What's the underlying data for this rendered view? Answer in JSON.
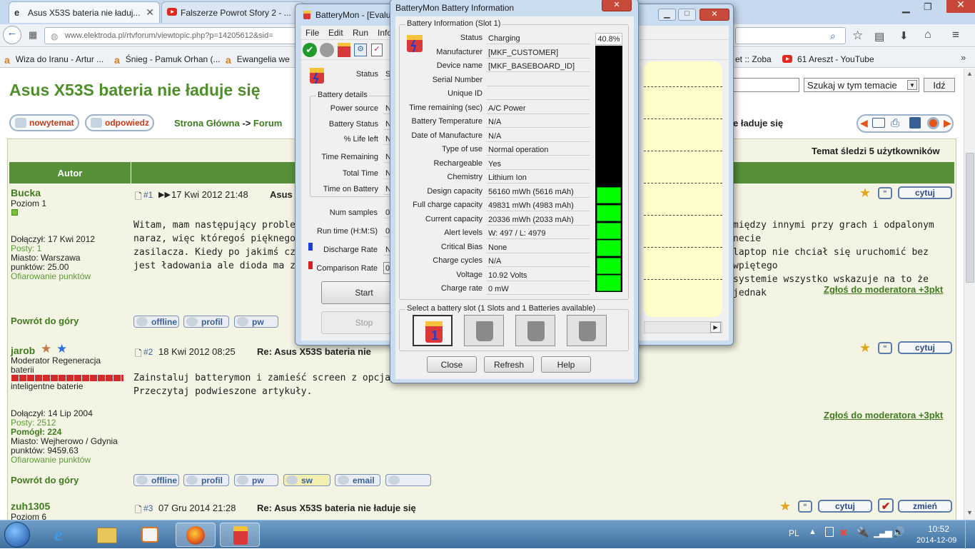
{
  "browser": {
    "tabs": [
      {
        "label": "Asus X53S bateria nie ładuj...",
        "active": true
      },
      {
        "label": "Falszerze Powrot Sfory 2 - ...",
        "active": false
      }
    ],
    "url": "www.elektroda.pl/rtvforum/viewtopic.php?p=14205612&sid=",
    "bookmarks": [
      "Wiza do Iranu - Artur ...",
      "Śnieg - Pamuk Orhan (...",
      "Ewangelia we",
      "et :: Zoba",
      "61 Areszt - YouTube"
    ]
  },
  "forum": {
    "topic_title": "Asus X53S bateria nie ładuje się",
    "search_placeholder": "Szukaj w tym temacie",
    "go_button": "Idź",
    "new_topic_button": "nowytemat",
    "reply_button": "odpowiedz",
    "breadcrumb_home": "Strona Główna",
    "breadcrumb_sep": "->",
    "breadcrumb_forum": "Forum",
    "breadcrumb_tail": "e ładuje się",
    "followers": "Temat śledzi 5 użytkowników",
    "author_header": "Autor",
    "back_to_top": "Powrót do góry",
    "report": "Zgłoś do moderatora +3pkt",
    "quote_label": "cytuj",
    "edit_label": "zmień",
    "posts": [
      {
        "user": "Bucka",
        "rank": "Poziom 1",
        "joined": "Dołączył: 17 Kwi 2012",
        "posts": "Posty: 1",
        "city": "Miasto: Warszawa",
        "points": "punktów: 25.00",
        "gift": "Ofiarowanie punktów",
        "num": "#1",
        "date": "17 Kwi 2012 21:48",
        "subject": "Asus",
        "lines": [
          "Witam, mam następujący problem",
          "naraz, więc któregoś pięknego dni",
          "zasilacza. Kiedy po jakimś czasie p",
          "jest ładowania ale dioda ma zapalo"
        ],
        "lines_right": [
          "między innymi przy grach i odpalonym necie",
          "laptop nie chciał się uruchomić bez wpiętego",
          "systemie wszystko wskazuje na to że jednak",
          ""
        ]
      },
      {
        "user": "jarob",
        "rank": "Moderator Regeneracja baterii",
        "subtitle": "inteligentne baterie",
        "joined": "Dołączył: 14 Lip 2004",
        "posts": "Posty: 2512",
        "helped": "Pomógł: 224",
        "city": "Miasto: Wejherowo / Gdynia",
        "points": "punktów: 9459.63",
        "gift": "Ofiarowanie punktów",
        "num": "#2",
        "date": "18 Kwi 2012 08:25",
        "subject": "Re: Asus X53S bateria nie",
        "lines": [
          "Zainstaluj batterymon i zamieść screen z opcjami bate",
          "Przeczytaj podwieszone artykuły."
        ]
      },
      {
        "user": "zuh1305",
        "rank": "Poziom 6",
        "num": "#3",
        "date": "07 Gru 2014 21:28",
        "subject": "Re: Asus X53S bateria nie ładuje się"
      }
    ],
    "user_buttons": [
      "offline",
      "profil",
      "pw",
      "sw",
      "email"
    ]
  },
  "batterymon": {
    "title": "BatteryMon - [Evalu",
    "menu": [
      "File",
      "Edit",
      "Run",
      "Info"
    ],
    "status_label": "Status",
    "status_value": "S",
    "details_group": "Battery details",
    "details": [
      {
        "label": "Power source",
        "value": "N"
      },
      {
        "label": "Battery Status",
        "value": "N"
      },
      {
        "label": "% Life left",
        "value": "N"
      },
      {
        "label": "Time Remaining",
        "value": "N"
      },
      {
        "label": "Total Time",
        "value": "N"
      },
      {
        "label": "Time on Battery",
        "value": "N"
      }
    ],
    "samples": [
      {
        "label": "Num samples",
        "value": "0"
      },
      {
        "label": "Run time (H:M:S)",
        "value": "0"
      },
      {
        "label": "Discharge Rate",
        "value": "N"
      },
      {
        "label": "Comparison Rate",
        "value": "0"
      }
    ],
    "start_button": "Start",
    "stop_button": "Stop"
  },
  "battery_info": {
    "title": "BatteryMon Battery Information",
    "group_title": "Battery Information (Slot 1)",
    "percent": "40.8%",
    "level": 0.408,
    "rows": [
      {
        "label": "Status",
        "value": "Charging"
      },
      {
        "label": "Manufacturer",
        "value": "[MKF_CUSTOMER]"
      },
      {
        "label": "Device name",
        "value": "[MKF_BASEBOARD_ID]"
      },
      {
        "label": "Serial Number",
        "value": ""
      },
      {
        "label": "Unique ID",
        "value": ""
      },
      {
        "label": "Time remaining (sec)",
        "value": "A/C Power"
      },
      {
        "label": "Battery Temperature",
        "value": "N/A"
      },
      {
        "label": "Date of Manufacture",
        "value": "N/A"
      },
      {
        "label": "Type of use",
        "value": "Normal operation"
      },
      {
        "label": "Rechargeable",
        "value": "Yes"
      },
      {
        "label": "Chemistry",
        "value": "Lithium Ion"
      },
      {
        "label": "Design capacity",
        "value": "56160 mWh (5616 mAh)"
      },
      {
        "label": "Full charge capacity",
        "value": "49831 mWh (4983 mAh)"
      },
      {
        "label": "Current capacity",
        "value": "20336 mWh (2033 mAh)"
      },
      {
        "label": "Alert levels",
        "value": "W: 497 / L: 4979"
      },
      {
        "label": "Critical Bias",
        "value": "None"
      },
      {
        "label": "Charge cycles",
        "value": "N/A"
      },
      {
        "label": "Voltage",
        "value": "10.92 Volts"
      },
      {
        "label": "Charge rate",
        "value": "0 mW"
      }
    ],
    "slot_group_title": "Select a battery slot (1 Slots and 1 Batteries available)",
    "slot_number": "1",
    "close_button": "Close",
    "refresh_button": "Refresh",
    "help_button": "Help"
  },
  "taskbar": {
    "language": "PL",
    "time": "10:52",
    "date": "2014-12-09"
  },
  "colors": {
    "forum_green": "#56913a",
    "gauge_green": "#00ff00",
    "brand_red": "#c63a16"
  }
}
